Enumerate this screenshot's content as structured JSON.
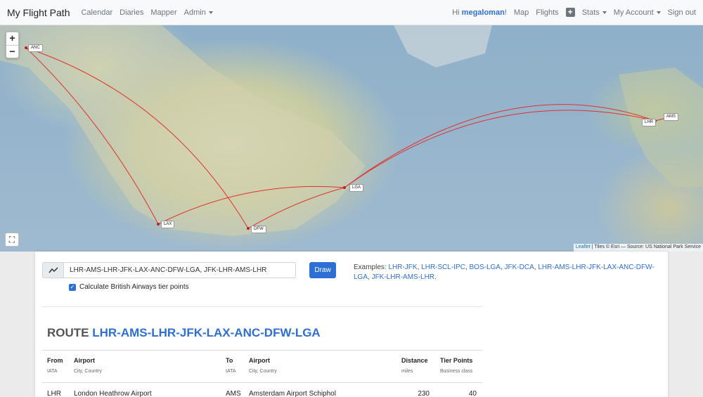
{
  "nav": {
    "brand": "My Flight Path",
    "links": [
      "Calendar",
      "Diaries",
      "Mapper",
      "Admin"
    ],
    "greeting_prefix": "Hi",
    "username": "megaloman",
    "greeting_suffix": "!",
    "right_links": [
      "Map",
      "Flights",
      "Stats",
      "My Account",
      "Sign out"
    ]
  },
  "map": {
    "zoom_in": "+",
    "zoom_out": "−",
    "attribution_leaflet": "Leaflet",
    "attribution_rest": " | Tiles © Esri — Source: US National Park Service",
    "airports": [
      "ANC",
      "LHR",
      "AMS",
      "LGA",
      "LAX",
      "DFW"
    ]
  },
  "form": {
    "route_value": "LHR-AMS-LHR-JFK-LAX-ANC-DFW-LGA, JFK-LHR-AMS-LHR",
    "draw_label": "Draw",
    "checkbox_label": "Calculate British Airways tier points",
    "examples_label": "Examples:",
    "examples": [
      "LHR-JFK",
      "LHR-SCL-IPC",
      "BOS-LGA",
      "JFK-DCA",
      "LHR-AMS-LHR-JFK-LAX-ANC-DFW-LGA",
      "JFK-LHR-AMS-LHR"
    ]
  },
  "route": {
    "title_prefix": "ROUTE",
    "code": "LHR-AMS-LHR-JFK-LAX-ANC-DFW-LGA"
  },
  "table": {
    "headers": {
      "from": "From",
      "from_sub": "IATA",
      "airport": "Airport",
      "airport_sub": "City, Country",
      "to": "To",
      "to_sub": "IATA",
      "airport2": "Airport",
      "airport2_sub": "City, Country",
      "distance": "Distance",
      "distance_sub": "miles",
      "tier": "Tier Points",
      "tier_sub": "Business class"
    },
    "rows": [
      {
        "from": "LHR",
        "from_airport": "London Heathrow Airport",
        "to": "AMS",
        "to_airport": "Amsterdam Airport Schiphol",
        "distance": "230",
        "tier": "40"
      }
    ]
  }
}
